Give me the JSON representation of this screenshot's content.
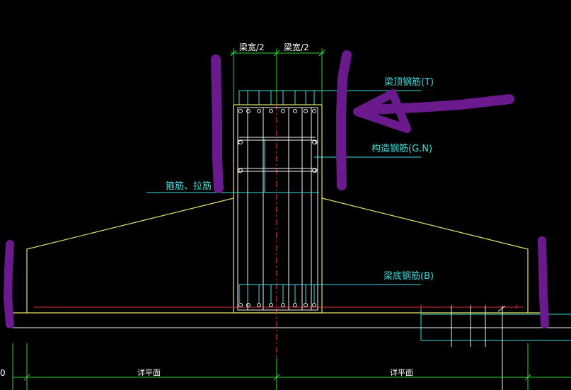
{
  "colors": {
    "background": "#000000",
    "section_outline": "#e8e06a",
    "stirrup_white": "#f2f2f2",
    "dimension_green": "#2fd23a",
    "leader_cyan": "#37e0e0",
    "centerline_red": "#e0303a",
    "bottom_bar_red": "#e0303a",
    "annotation_purple": "#6a1a8c"
  },
  "labels": {
    "half_width_left": "梁宽/2",
    "half_width_right": "梁宽/2",
    "top_rebar": "梁顶钢筋(T)",
    "structural_rebar": "构造钢筋(G.N)",
    "stirrup_tie": "箍筋、拉筋",
    "bottom_rebar": "梁底钢筋(B)",
    "detail_left": "详平面",
    "detail_right": "详平面",
    "edge_char": "0"
  },
  "annotations": {
    "arrow_icon": "arrow-pointing-left-icon",
    "marker_strokes": 4
  }
}
